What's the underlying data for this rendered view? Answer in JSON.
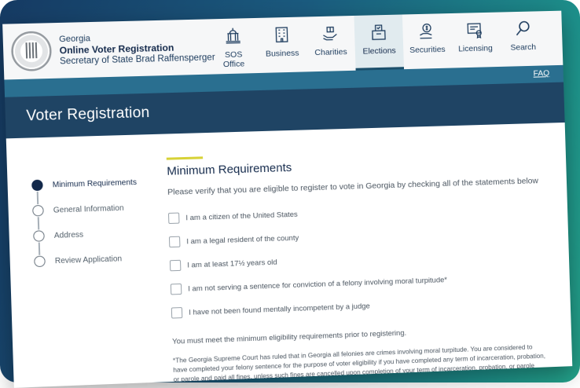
{
  "brand": {
    "state": "Georgia",
    "title": "Online Voter Registration",
    "subtitle": "Secretary of State Brad Raffensperger"
  },
  "nav": {
    "items": [
      {
        "line1": "SOS",
        "line2": "Office",
        "icon": "capitol-icon"
      },
      {
        "line1": "Business",
        "line2": "",
        "icon": "building-icon"
      },
      {
        "line1": "Charities",
        "line2": "",
        "icon": "charity-hands-icon"
      },
      {
        "line1": "Elections",
        "line2": "",
        "icon": "ballot-box-icon"
      },
      {
        "line1": "Securities",
        "line2": "",
        "icon": "money-hand-icon"
      },
      {
        "line1": "Licensing",
        "line2": "",
        "icon": "certificate-icon"
      },
      {
        "line1": "Search",
        "line2": "",
        "icon": "search-icon"
      }
    ],
    "active": "Elections"
  },
  "faq": "FAQ",
  "page_title": "Voter Registration",
  "steps": [
    {
      "label": "Minimum Requirements",
      "current": true
    },
    {
      "label": "General Information",
      "current": false
    },
    {
      "label": "Address",
      "current": false
    },
    {
      "label": "Review Application",
      "current": false
    }
  ],
  "main": {
    "title": "Minimum Requirements",
    "intro": "Please verify that you are eligible to register to vote in Georgia by checking all of the statements below",
    "checks": [
      "I am a citizen of the United States",
      "I am a legal resident of the county",
      "I am at least 17½ years old",
      "I am not serving a sentence for conviction of a felony involving moral turpitude*",
      "I have not been found mentally incompetent by a judge"
    ],
    "note": "You must meet the minimum eligibility requirements prior to registering.",
    "footnote": "*The Georgia Supreme Court has ruled that in Georgia all felonies are crimes involving moral turpitude. You are considered to have completed your felony sentence for the purpose of voter eligibility if you have completed any term of incarceration, probation, or parole and paid all fines, unless such fines are cancelled upon completion of your term of incarceration, probation, or parole (e.g.,"
  },
  "colors": {
    "navy": "#13294b",
    "banner": "#2a6f90",
    "titlebar": "#1f4464",
    "accent": "#d7d237",
    "background_left": "#153a63",
    "background_right": "#23a38a"
  }
}
